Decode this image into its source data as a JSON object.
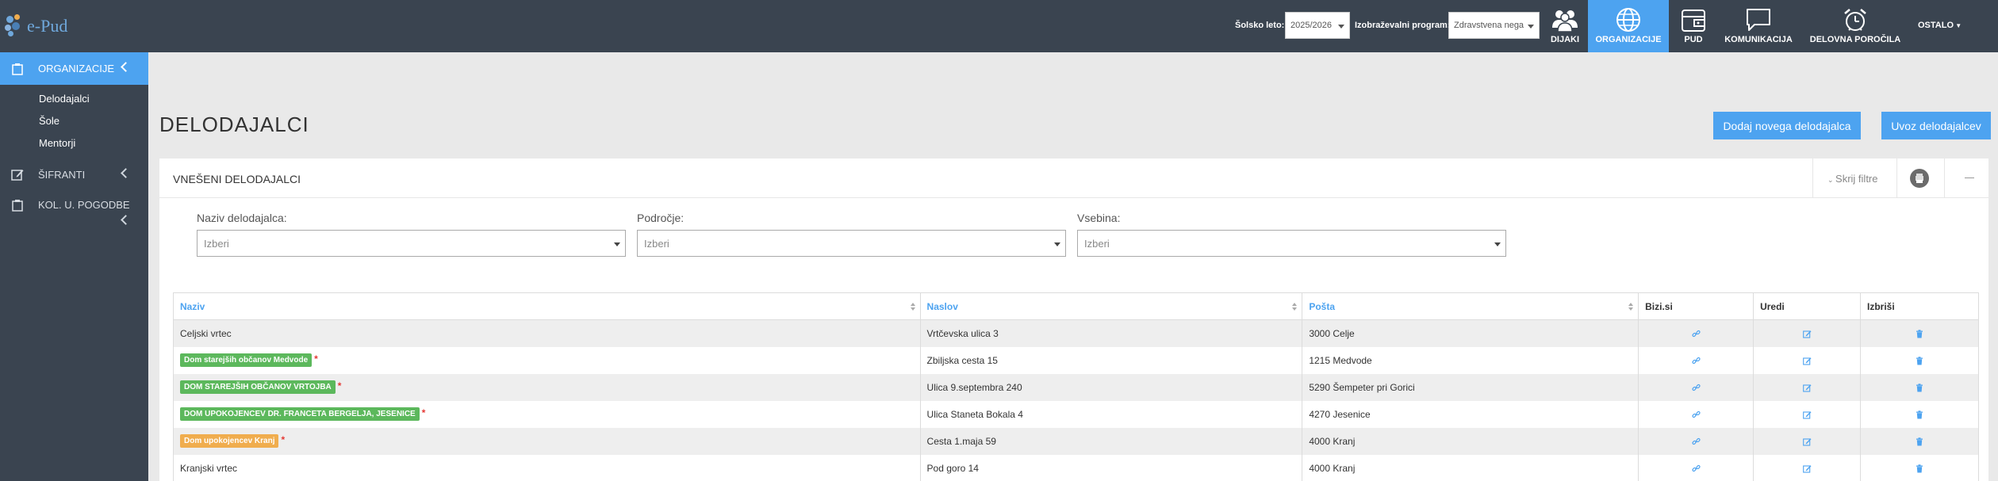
{
  "app": {
    "logo_text": "e-Pud"
  },
  "topbar": {
    "solsko_leto_label": "Šolsko leto:",
    "solsko_leto_value": "2025/2026",
    "program_label": "Izobraževalni program:",
    "program_value": "Zdravstvena nega",
    "nav": [
      {
        "label": "DIJAKI",
        "icon": "users-icon"
      },
      {
        "label": "ORGANIZACIJE",
        "icon": "globe-icon",
        "active": true
      },
      {
        "label": "PUD",
        "icon": "wallet-icon"
      },
      {
        "label": "KOMUNIKACIJA",
        "icon": "chat-icon"
      },
      {
        "label": "DELOVNA POROČILA",
        "icon": "alarm-clock-icon"
      }
    ],
    "ostalo": "OSTALO"
  },
  "sidebar": {
    "organizacije": "ORGANIZACIJE",
    "sub_items": [
      "Delodajalci",
      "Šole",
      "Mentorji"
    ],
    "sifranti": "ŠIFRANTI",
    "kol_pogodbe": "KOL. U. POGODBE"
  },
  "page": {
    "title": "DELODAJALCI",
    "btn_add": "Dodaj novega delodajalca",
    "btn_import": "Uvoz delodajalcev"
  },
  "panel": {
    "title": "VNEŠENI DELODAJALCI",
    "hide_filters": "Skrij filtre",
    "filters": [
      {
        "label": "Naziv delodajalca:",
        "value": "Izberi"
      },
      {
        "label": "Področje:",
        "value": "Izberi"
      },
      {
        "label": "Vsebina:",
        "value": "Izberi"
      }
    ]
  },
  "table": {
    "headers": [
      "Naziv",
      "Naslov",
      "Pošta",
      "Bizi.si",
      "Uredi",
      "Izbriši"
    ],
    "rows": [
      {
        "naziv": "Celjski vrtec",
        "tag": false,
        "naslov": "Vrtčevska ulica 3",
        "posta": "3000 Celje"
      },
      {
        "naziv": "Dom starejših občanov Medvode",
        "tag": true,
        "tag_color": "#5cb85c",
        "required": "*",
        "naslov": "Zbiljska cesta 15",
        "posta": "1215 Medvode"
      },
      {
        "naziv": "DOM STAREJŠIH OBČANOV VRTOJBA",
        "tag": true,
        "tag_color": "#5cb85c",
        "required": "*",
        "naslov": "Ulica 9.septembra 240",
        "posta": "5290 Šempeter pri Gorici"
      },
      {
        "naziv": "DOM UPOKOJENCEV DR. FRANCETA BERGELJA, JESENICE",
        "tag": true,
        "tag_color": "#5cb85c",
        "required": "*",
        "naslov": "Ulica Staneta Bokala 4",
        "posta": "4270 Jesenice"
      },
      {
        "naziv": "Dom upokojencev Kranj",
        "tag": true,
        "tag_color": "#f0ad4e",
        "required": "*",
        "naslov": "Cesta 1.maja 59",
        "posta": "4000 Kranj"
      },
      {
        "naziv": "Kranjski vrtec",
        "tag": false,
        "naslov": "Pod goro 14",
        "posta": "4000 Kranj"
      }
    ]
  },
  "colors": {
    "accent": "#4da3f0",
    "topbar": "#3a4450",
    "tag_green": "#5cb85c",
    "tag_orange": "#f0ad4e"
  }
}
